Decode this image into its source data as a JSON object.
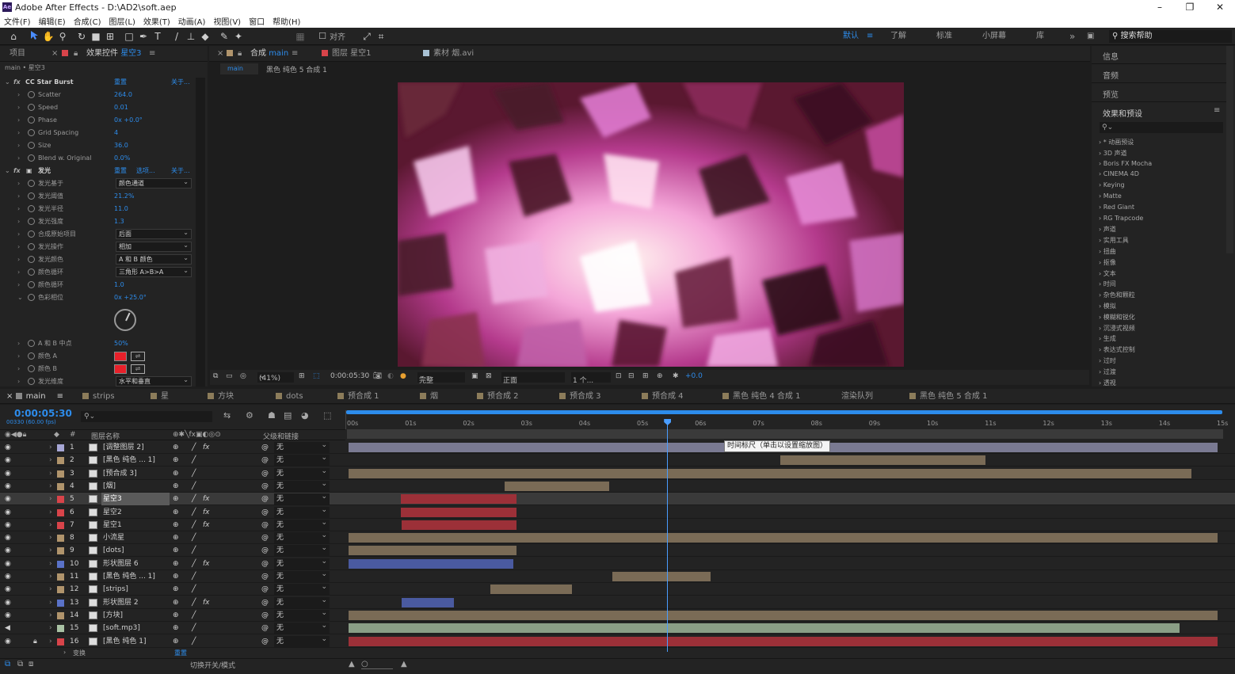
{
  "window": {
    "title": "Adobe After Effects - D:\\AD2\\soft.aep",
    "logo": "Ae",
    "minimize": "–",
    "maximize": "❐",
    "close": "✕"
  },
  "menu": [
    "文件(F)",
    "编辑(E)",
    "合成(C)",
    "图层(L)",
    "效果(T)",
    "动画(A)",
    "视图(V)",
    "窗口",
    "帮助(H)"
  ],
  "toolbar": {
    "snap_label": "对齐",
    "workspaces": {
      "default": "默认",
      "learn": "了解",
      "standard": "标准",
      "small": "小屏幕",
      "library": "库",
      "more": "»"
    },
    "search_help": "搜索帮助"
  },
  "effects_panel": {
    "tab_project": "项目",
    "tab_effects": "效果控件",
    "tab_layer": "星空3",
    "breadcrumb": "main • 星空3",
    "fx1": {
      "name": "CC Star Burst",
      "reset": "重置",
      "about": "关于..."
    },
    "fx1_props": [
      {
        "name": "Scatter",
        "value": "264.0"
      },
      {
        "name": "Speed",
        "value": "0.01"
      },
      {
        "name": "Phase",
        "value": "0x +0.0°"
      },
      {
        "name": "Grid Spacing",
        "value": "4"
      },
      {
        "name": "Size",
        "value": "36.0"
      },
      {
        "name": "Blend w. Original",
        "value": "0.0%"
      }
    ],
    "fx2": {
      "name": "发光",
      "reset": "重置",
      "options": "选项...",
      "about": "关于..."
    },
    "fx2_props": [
      {
        "name": "发光基于",
        "dropdown": "颜色通道"
      },
      {
        "name": "发光阈值",
        "value": "21.2%"
      },
      {
        "name": "发光半径",
        "value": "11.0"
      },
      {
        "name": "发光强度",
        "value": "1.3"
      },
      {
        "name": "合成原始项目",
        "dropdown": "后面"
      },
      {
        "name": "发光操作",
        "dropdown": "相加"
      },
      {
        "name": "发光颜色",
        "dropdown": "A 和 B 颜色"
      },
      {
        "name": "颜色循环",
        "dropdown": "三角形 A>B>A"
      },
      {
        "name": "颜色循环",
        "value": "1.0"
      },
      {
        "name": "色彩相位",
        "value": "0x +25.0°"
      }
    ],
    "fx2_props2": [
      {
        "name": "A 和 B 中点",
        "value": "50%"
      },
      {
        "name": "颜色 A",
        "color": "#e8202a"
      },
      {
        "name": "颜色 B",
        "color": "#e8202a"
      },
      {
        "name": "发光维度",
        "dropdown": "水平和垂直"
      }
    ]
  },
  "composition_panel": {
    "tab_comp": "合成",
    "tab_comp_name": "main",
    "tab_layer": "图层 星空1",
    "tab_footage": "素材 烟.avi",
    "crumb_main": "main",
    "crumb_other": "黑色 纯色 5 合成 1",
    "zoom": "(41%)",
    "timecode": "0:00:05:30",
    "resolution": "完整",
    "view": "正面",
    "views_count": "1 个...",
    "exposure": "+0.0"
  },
  "right_panel": {
    "info": "信息",
    "audio": "音频",
    "preview": "预览",
    "effects_presets": "效果和预设",
    "categories": [
      "* 动画预设",
      "3D 声道",
      "Boris FX Mocha",
      "CINEMA 4D",
      "Keying",
      "Matte",
      "Red Giant",
      "RG Trapcode",
      "声道",
      "实用工具",
      "扭曲",
      "抠像",
      "文本",
      "时间",
      "杂色和颗粒",
      "模拟",
      "模糊和锐化",
      "沉浸式视频",
      "生成",
      "表达式控制",
      "过时",
      "过渡",
      "透视"
    ]
  },
  "timeline": {
    "tabs": [
      "main",
      "strips",
      "星",
      "方块",
      "dots",
      "预合成 1",
      "烟",
      "预合成 2",
      "预合成 3",
      "预合成 4",
      "黑色 纯色 4 合成 1",
      "渲染队列",
      "黑色 纯色 5 合成 1"
    ],
    "tab_colors": [
      "#888888",
      "#8c7c5a",
      "#8c7c5a",
      "#8c7c5a",
      "#8c7c5a",
      "#8c7c5a",
      "#8c7c5a",
      "#8c7c5a",
      "#8c7c5a",
      "#8c7c5a",
      "#8c7c5a",
      "",
      "#8c7c5a"
    ],
    "timecode": "0:00:05:30",
    "frame_info": "00330 (60.00 fps)",
    "col_name": "图层名称",
    "col_parent": "父级和链接",
    "ruler": [
      "00s",
      "01s",
      "02s",
      "03s",
      "04s",
      "05s",
      "06s",
      "07s",
      "08s",
      "09s",
      "10s",
      "11s",
      "12s",
      "13s",
      "14s",
      "15s"
    ],
    "tooltip": "时间标尺（单击以设置缩放图）",
    "footer_transform": "变换",
    "footer_reset": "重置",
    "footer_toggle": "切换开关/模式",
    "layers": [
      {
        "num": "1",
        "name": "[调整图层 2]",
        "label": "#a7a7d6",
        "parent": "无",
        "fx": "fx",
        "start": 0.0,
        "end": 15.0
      },
      {
        "num": "2",
        "name": "[黑色 纯色 ... 1]",
        "label": "#b0946c",
        "parent": "无",
        "fx": "",
        "start": 7.45,
        "end": 11.0
      },
      {
        "num": "3",
        "name": "[预合成 3]",
        "label": "#b0946c",
        "parent": "无",
        "fx": "",
        "start": 0.0,
        "end": 14.55
      },
      {
        "num": "4",
        "name": "[烟]",
        "label": "#b0946c",
        "parent": "无",
        "fx": "",
        "start": 2.7,
        "end": 4.5
      },
      {
        "num": "5",
        "name": "星空3",
        "label": "#d8444a",
        "parent": "无",
        "fx": "fx",
        "start": 0.9,
        "end": 2.9
      },
      {
        "num": "6",
        "name": "星空2",
        "label": "#d8444a",
        "parent": "无",
        "fx": "fx",
        "start": 0.9,
        "end": 2.9
      },
      {
        "num": "7",
        "name": "星空1",
        "label": "#d8444a",
        "parent": "无",
        "fx": "fx",
        "start": 0.92,
        "end": 2.9
      },
      {
        "num": "8",
        "name": "小流星",
        "label": "#b0946c",
        "parent": "无",
        "fx": "",
        "start": 0.0,
        "end": 15.0
      },
      {
        "num": "9",
        "name": "[dots]",
        "label": "#b0946c",
        "parent": "无",
        "fx": "",
        "start": 0.0,
        "end": 2.9
      },
      {
        "num": "10",
        "name": "形状图层 6",
        "label": "#5a72c8",
        "parent": "无",
        "fx": "fx",
        "start": 0.0,
        "end": 2.85
      },
      {
        "num": "11",
        "name": "[黑色 纯色 ... 1]",
        "label": "#b0946c",
        "parent": "无",
        "fx": "",
        "start": 4.55,
        "end": 6.25
      },
      {
        "num": "12",
        "name": "[strips]",
        "label": "#b0946c",
        "parent": "无",
        "fx": "",
        "start": 2.45,
        "end": 3.85
      },
      {
        "num": "13",
        "name": "形状图层 2",
        "label": "#5a72c8",
        "parent": "无",
        "fx": "fx",
        "start": 0.92,
        "end": 1.82
      },
      {
        "num": "14",
        "name": "[方块]",
        "label": "#b0946c",
        "parent": "无",
        "fx": "",
        "start": 0.0,
        "end": 15.0
      },
      {
        "num": "15",
        "name": "[soft.mp3]",
        "label": "#a9c2a4",
        "parent": "无",
        "fx": "",
        "start": 0.0,
        "end": 14.35
      },
      {
        "num": "16",
        "name": "[黑色 纯色 1]",
        "label": "#d8444a",
        "parent": "无",
        "fx": "",
        "start": 0.0,
        "end": 15.0
      }
    ],
    "playhead_seconds": 5.5
  },
  "colors": {
    "accent": "#2d8ceb",
    "panel": "#232323",
    "background": "#1d1d1d"
  }
}
